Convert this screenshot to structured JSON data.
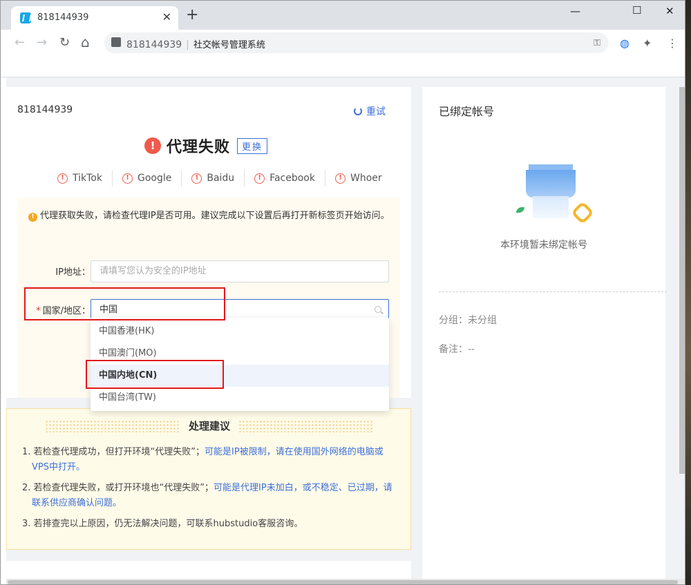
{
  "browser": {
    "tab_title": "818144939",
    "tab_close": "✕",
    "new_tab": "+",
    "win_min": "—",
    "win_max": "☐",
    "win_close": "✕",
    "nav_back": "←",
    "nav_forward": "→",
    "nav_reload": "↻",
    "nav_home": "⌂",
    "address_host": "818144939",
    "address_sep": "|",
    "address_page_title": "社交帐号管理系统",
    "key_icon": "⚿",
    "globe_icon": "◍",
    "puzzle_icon": "✦",
    "menu_icon": "⋮"
  },
  "env": {
    "id": "818144939",
    "retry_label": "重试",
    "status_icon": "!",
    "status_text": "代理失败",
    "change_label": "更换"
  },
  "checkers": [
    {
      "label": "TikTok"
    },
    {
      "label": "Google"
    },
    {
      "label": "Baidu"
    },
    {
      "label": "Facebook"
    },
    {
      "label": "Whoer"
    }
  ],
  "checker_icon": "!",
  "notice": {
    "icon": "!",
    "text": "代理获取失败，请检查代理IP是否可用。建议完成以下设置后再打开新标签页开始访问。"
  },
  "form": {
    "ip_label": "IP地址：",
    "ip_placeholder": "请填写您认为安全的IP地址",
    "country_required": "*",
    "country_label": "国家/地区：",
    "country_value": "中国"
  },
  "dropdown": {
    "options": [
      "中国香港(HK)",
      "中国澳门(MO)",
      "中国内地(CN)",
      "中国台湾(TW)"
    ],
    "active_index": 2
  },
  "advice": {
    "title": "处理建议",
    "items": [
      {
        "prefix": "1. 若检查代理成功，但打开环境“代理失败”；",
        "blue": "可能是IP被限制，请在使用国外网络的电脑或VPS中打开。"
      },
      {
        "prefix": "2. 若检查代理失败，或打开环境也“代理失败”；",
        "blue": "可能是代理IP未加白，或不稳定、已过期，请联系供应商确认问题。"
      },
      {
        "prefix": "3. 若排查完以上原因，仍无法解决问题，可联系hubstudio客服咨询。",
        "blue": ""
      }
    ]
  },
  "bound": {
    "title": "已绑定帐号",
    "empty_text": "本环境暂未绑定帐号",
    "group_label": "分组：",
    "group_value": "未分组",
    "remark_label": "备注：",
    "remark_value": "--"
  },
  "colors": {
    "accent": "#3d6fd9",
    "error": "#ef5a4c",
    "warning": "#f5a623",
    "highlight": "#e0181b"
  }
}
